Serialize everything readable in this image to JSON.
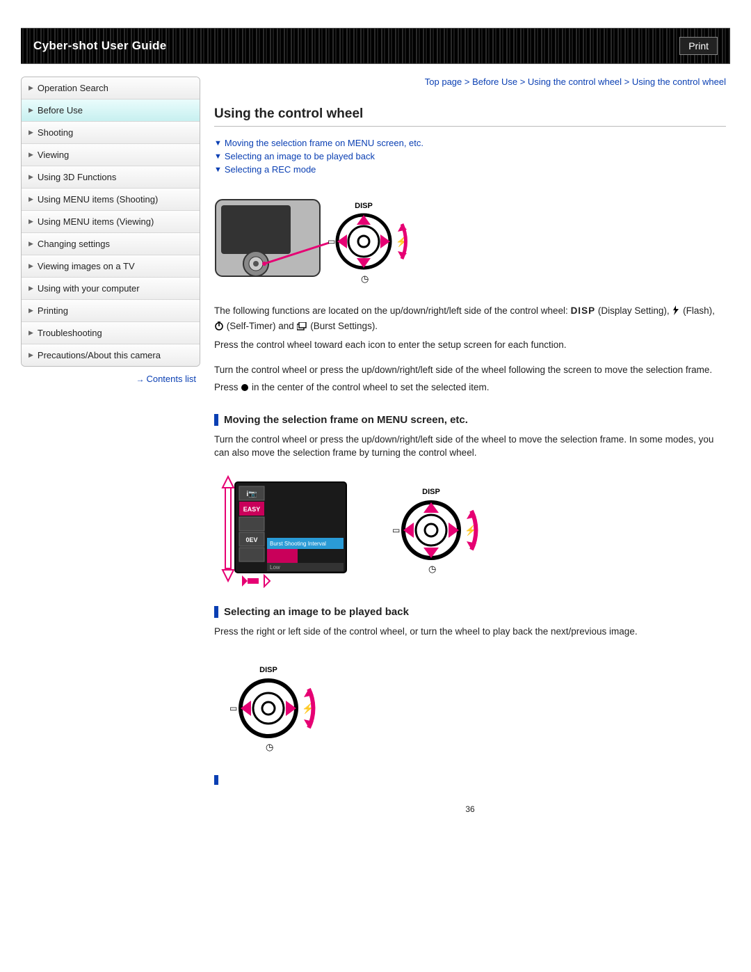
{
  "header": {
    "title": "Cyber-shot User Guide",
    "print": "Print"
  },
  "breadcrumb": "Top page > Before Use > Using the control wheel > Using the control wheel",
  "sidebar": {
    "items": [
      {
        "label": "Operation Search",
        "active": false
      },
      {
        "label": "Before Use",
        "active": true
      },
      {
        "label": "Shooting",
        "active": false
      },
      {
        "label": "Viewing",
        "active": false
      },
      {
        "label": "Using 3D Functions",
        "active": false
      },
      {
        "label": "Using MENU items (Shooting)",
        "active": false
      },
      {
        "label": "Using MENU items (Viewing)",
        "active": false
      },
      {
        "label": "Changing settings",
        "active": false
      },
      {
        "label": "Viewing images on a TV",
        "active": false
      },
      {
        "label": "Using with your computer",
        "active": false
      },
      {
        "label": "Printing",
        "active": false
      },
      {
        "label": "Troubleshooting",
        "active": false
      },
      {
        "label": "Precautions/About this camera",
        "active": false
      }
    ],
    "contents_link": "Contents list"
  },
  "page": {
    "h1": "Using the control wheel",
    "toc": [
      "Moving the selection frame on MENU screen, etc.",
      "Selecting an image to be played back",
      "Selecting a REC mode"
    ],
    "p1a": "The following functions are located on the up/down/right/left side of the control wheel: ",
    "disp": "DISP",
    "p1b": " (Display Setting), ",
    "p1c": " (Flash), ",
    "p1d": " (Self-Timer) and ",
    "p1e": " (Burst Settings).",
    "p2": "Press the control wheel toward each icon to enter the setup screen for each function.",
    "p3": "Turn the control wheel or press the up/down/right/left side of the wheel following the screen to move the selection frame.",
    "p4a": "Press ",
    "p4b": " in the center of the control wheel to set the selected item.",
    "h2a": "Moving the selection frame on MENU screen, etc.",
    "p5": "Turn the control wheel or press the up/down/right/left side of the wheel to move the selection frame. In some modes, you can also move the selection frame by turning the control wheel.",
    "h2b": "Selecting an image to be played back",
    "p6": "Press the right or left side of the control wheel, or turn the wheel to play back the next/previous image.",
    "page_number": "36",
    "icon_labels": {
      "disp_top": "DISP",
      "menu_items": [
        "i",
        "EASY",
        "",
        "0EV",
        ""
      ],
      "menu_popup_title": "Burst Shooting Interval",
      "menu_popup_low": "Low"
    }
  }
}
